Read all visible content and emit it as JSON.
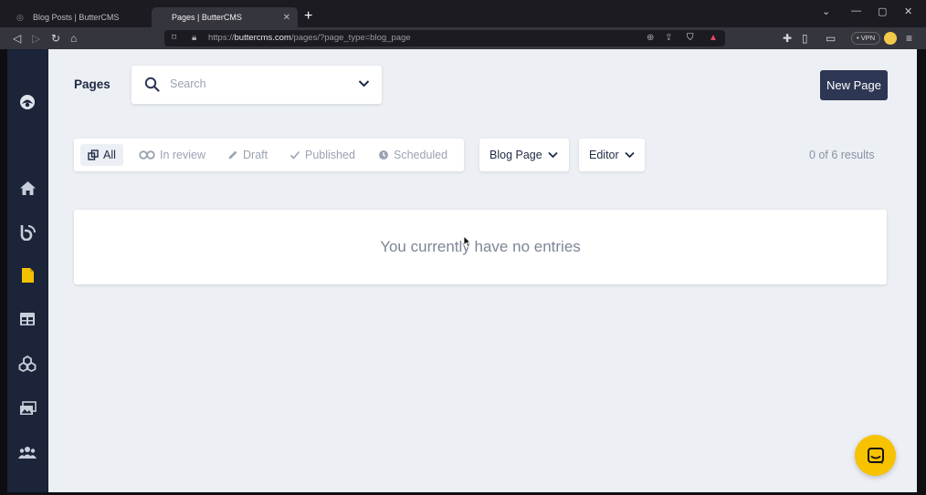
{
  "browser": {
    "tabs": [
      {
        "label": "Blog Posts | ButterCMS",
        "active": false
      },
      {
        "label": "Pages | ButterCMS",
        "active": true
      }
    ],
    "url_scheme": "https://",
    "url_host": "buttercms.com",
    "url_path": "/pages/?page_type=blog_page",
    "vpn_label": "• VPN"
  },
  "sidebar": {
    "items": [
      {
        "icon": "butter-logo-icon"
      },
      {
        "icon": "home-icon"
      },
      {
        "icon": "blog-icon"
      },
      {
        "icon": "page-icon"
      },
      {
        "icon": "collections-icon"
      },
      {
        "icon": "components-icon"
      },
      {
        "icon": "media-icon"
      },
      {
        "icon": "users-icon"
      }
    ]
  },
  "header": {
    "title": "Pages",
    "search_placeholder": "Search",
    "new_page_label": "New Page"
  },
  "filters": {
    "tabs": [
      {
        "label": "All",
        "icon": "copy-icon",
        "active": true
      },
      {
        "label": "In review",
        "icon": "review-icon",
        "active": false
      },
      {
        "label": "Draft",
        "icon": "pencil-icon",
        "active": false
      },
      {
        "label": "Published",
        "icon": "check-icon",
        "active": false
      },
      {
        "label": "Scheduled",
        "icon": "clock-icon",
        "active": false
      }
    ],
    "page_type_label": "Blog Page",
    "editor_label": "Editor",
    "results_text": "0 of 6 results"
  },
  "empty_message": "You currently have no entries",
  "colors": {
    "sidebar": "#1b2438",
    "primary_button": "#2d3653",
    "chat_bubble": "#f7c200",
    "background": "#eceff4"
  }
}
